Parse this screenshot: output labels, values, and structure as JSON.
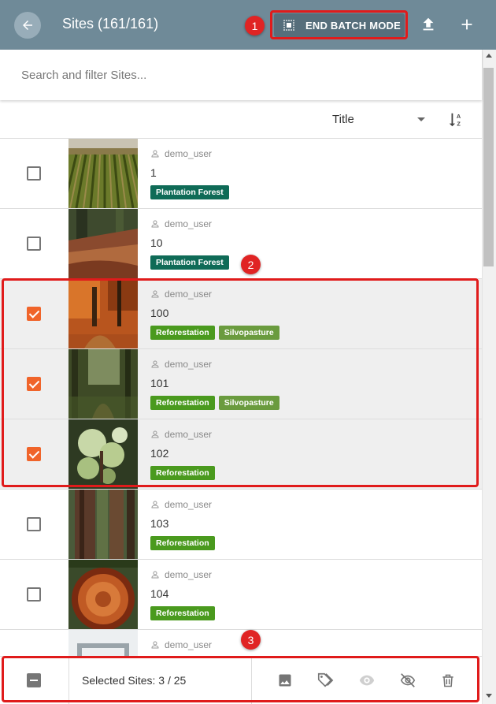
{
  "header": {
    "title": "Sites (161/161)",
    "batch_button_label": "END BATCH MODE",
    "background": "#6f8a98"
  },
  "annotations": [
    "1",
    "2",
    "3"
  ],
  "search": {
    "placeholder": "Search and filter Sites..."
  },
  "sort": {
    "field": "Title",
    "icon": "sort-alpha-asc-icon"
  },
  "rows": [
    {
      "user": "demo_user",
      "name": "1",
      "checked": false,
      "tags": [
        {
          "label": "Plantation Forest",
          "color": "#0f6b57"
        }
      ]
    },
    {
      "user": "demo_user",
      "name": "10",
      "checked": false,
      "tags": [
        {
          "label": "Plantation Forest",
          "color": "#0f6b57"
        }
      ]
    },
    {
      "user": "demo_user",
      "name": "100",
      "checked": true,
      "tags": [
        {
          "label": "Reforestation",
          "color": "#4a9a1e"
        },
        {
          "label": "Silvopasture",
          "color": "#6a9b3e"
        }
      ]
    },
    {
      "user": "demo_user",
      "name": "101",
      "checked": true,
      "tags": [
        {
          "label": "Reforestation",
          "color": "#4a9a1e"
        },
        {
          "label": "Silvopasture",
          "color": "#6a9b3e"
        }
      ]
    },
    {
      "user": "demo_user",
      "name": "102",
      "checked": true,
      "tags": [
        {
          "label": "Reforestation",
          "color": "#4a9a1e"
        }
      ]
    },
    {
      "user": "demo_user",
      "name": "103",
      "checked": false,
      "tags": [
        {
          "label": "Reforestation",
          "color": "#4a9a1e"
        }
      ]
    },
    {
      "user": "demo_user",
      "name": "104",
      "checked": false,
      "tags": [
        {
          "label": "Reforestation",
          "color": "#4a9a1e"
        }
      ]
    },
    {
      "user": "demo_user",
      "name": "",
      "checked": false,
      "tags": []
    }
  ],
  "bottom_bar": {
    "selected_text": "Selected Sites: 3 / 25",
    "icons": [
      "image-icon",
      "tags-icon",
      "eye-icon",
      "eye-off-icon",
      "trash-icon"
    ]
  },
  "colors": {
    "accent": "#f0642a",
    "highlight_outline": "#e01b1b",
    "selected_row_bg": "#efefef"
  }
}
